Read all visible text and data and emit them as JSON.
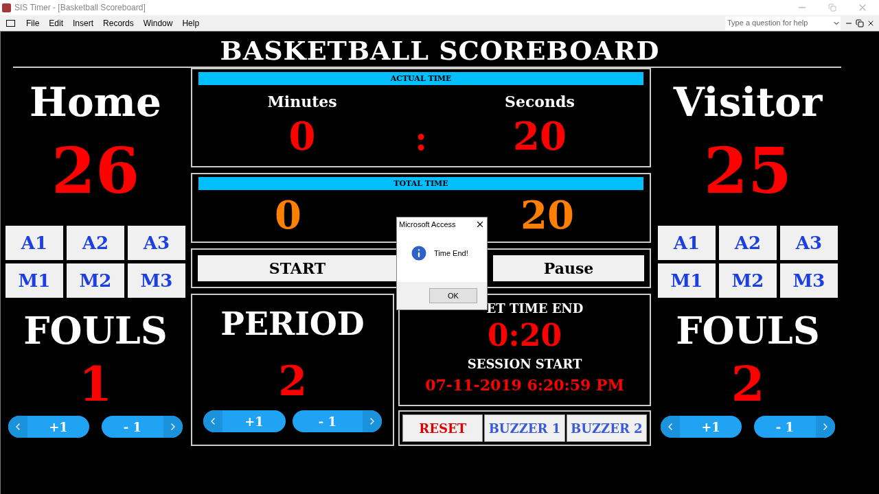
{
  "window": {
    "title": "SIS Timer - [Basketball Scoreboard]"
  },
  "menu": [
    "File",
    "Edit",
    "Insert",
    "Records",
    "Window",
    "Help"
  ],
  "help_search": {
    "placeholder": "Type a question for help"
  },
  "title": "BASKETBALL SCOREBOARD",
  "teams": [
    {
      "name": "Home",
      "score": "26",
      "shots": [
        "A1",
        "A2",
        "A3",
        "M1",
        "M2",
        "M3"
      ],
      "fouls_label": "FOULS",
      "fouls": "1",
      "plus": "+1",
      "minus": "- 1"
    },
    {
      "name": "Visitor",
      "score": "25",
      "shots": [
        "A1",
        "A2",
        "A3",
        "M1",
        "M2",
        "M3"
      ],
      "fouls_label": "FOULS",
      "fouls": "2",
      "plus": "+1",
      "minus": "- 1"
    }
  ],
  "actual_time": {
    "header": "ACTUAL TIME",
    "minutes_label": "Minutes",
    "seconds_label": "Seconds",
    "minutes": "0",
    "separator": ":",
    "seconds": "20"
  },
  "total_time": {
    "header": "TOTAL TIME",
    "minutes": "0",
    "seconds": "20"
  },
  "controls": {
    "start": "START",
    "pause": "Pause"
  },
  "period": {
    "label": "PERIOD",
    "value": "2",
    "plus": "+1",
    "minus": "- 1"
  },
  "time_end": {
    "label": "ET TIME END",
    "value": "0:20",
    "session_label": "SESSION START",
    "session_value": "07-11-2019 6:20:59 PM"
  },
  "actions": [
    {
      "label": "RESET",
      "kind": "reset"
    },
    {
      "label": "BUZZER 1",
      "kind": "buzzer"
    },
    {
      "label": "BUZZER 2",
      "kind": "buzzer"
    }
  ],
  "dialog": {
    "title": "Microsoft Access",
    "message": "Time End!",
    "button": "OK"
  }
}
